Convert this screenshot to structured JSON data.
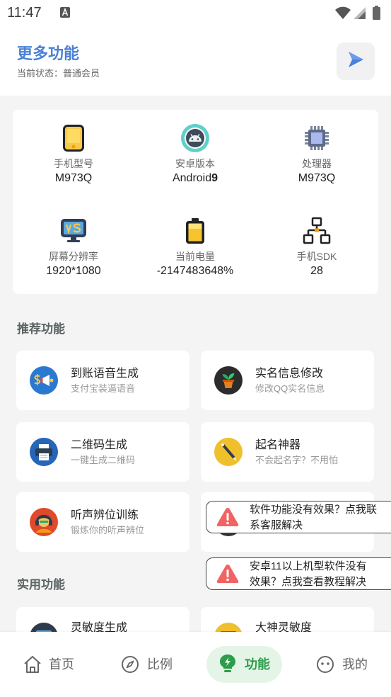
{
  "status_bar": {
    "time": "11:47",
    "icons": [
      "a-notification-icon",
      "wifi-icon",
      "signal-icon",
      "battery-status-icon"
    ]
  },
  "header": {
    "title": "更多功能",
    "subtitle": "当前状态：普通会员",
    "action_icon": "play-send-icon"
  },
  "device_info": {
    "items": [
      {
        "icon": "phone-icon",
        "label": "手机型号",
        "value": "M973Q"
      },
      {
        "icon": "android-icon",
        "label": "安卓版本",
        "value": "Android",
        "value_bold": "9"
      },
      {
        "icon": "processor-chip-icon",
        "label": "处理器",
        "value": "M973Q"
      },
      {
        "icon": "monitor-vs-icon",
        "label": "屏幕分辨率",
        "value": "1920*1080"
      },
      {
        "icon": "battery-icon",
        "label": "当前电量",
        "value": "-2147483648%"
      },
      {
        "icon": "network-hierarchy-icon",
        "label": "手机SDK",
        "value": "28"
      }
    ]
  },
  "recommended": {
    "title": "推荐功能",
    "items": [
      {
        "icon": "money-megaphone-icon",
        "title": "到账语音生成",
        "subtitle": "支付宝装逼语音"
      },
      {
        "icon": "plant-pot-icon",
        "title": "实名信息修改",
        "subtitle": "修改QQ实名信息"
      },
      {
        "icon": "printer-icon",
        "title": "二维码生成",
        "subtitle": "一键生成二维码"
      },
      {
        "icon": "pen-icon",
        "title": "起名神器",
        "subtitle": "不会起名字？不用怕"
      },
      {
        "icon": "headphones-person-icon",
        "title": "听声辨位训练",
        "subtitle": "锻炼你的听声辨位"
      },
      {
        "icon": "dark-circle-icon"
      }
    ]
  },
  "utility": {
    "title": "实用功能",
    "items": [
      {
        "icon": "screen-icon",
        "title": "灵敏度生成"
      },
      {
        "icon": "folder-icon",
        "title": "大神灵敏度"
      }
    ]
  },
  "popups": [
    {
      "icon": "warning-icon",
      "lines": [
        "软件功能没有效果？点我联",
        "系客服解决"
      ]
    },
    {
      "icon": "warning-icon",
      "lines": [
        "安卓11以上机型软件没有",
        "效果？点我查看教程解决"
      ]
    }
  ],
  "bottom_nav": {
    "items": [
      {
        "icon": "home-icon",
        "label": "首页",
        "active": false
      },
      {
        "icon": "compass-icon",
        "label": "比例",
        "active": false
      },
      {
        "icon": "lightbulb-icon",
        "label": "功能",
        "active": true
      },
      {
        "icon": "face-icon",
        "label": "我的",
        "active": false
      }
    ]
  },
  "colors": {
    "accent_blue": "#4a80d8",
    "active_green": "#2e9d4a",
    "active_pill": "#e4f5e7",
    "warning_red": "#f26464",
    "page_background": "#f4f4f4"
  }
}
